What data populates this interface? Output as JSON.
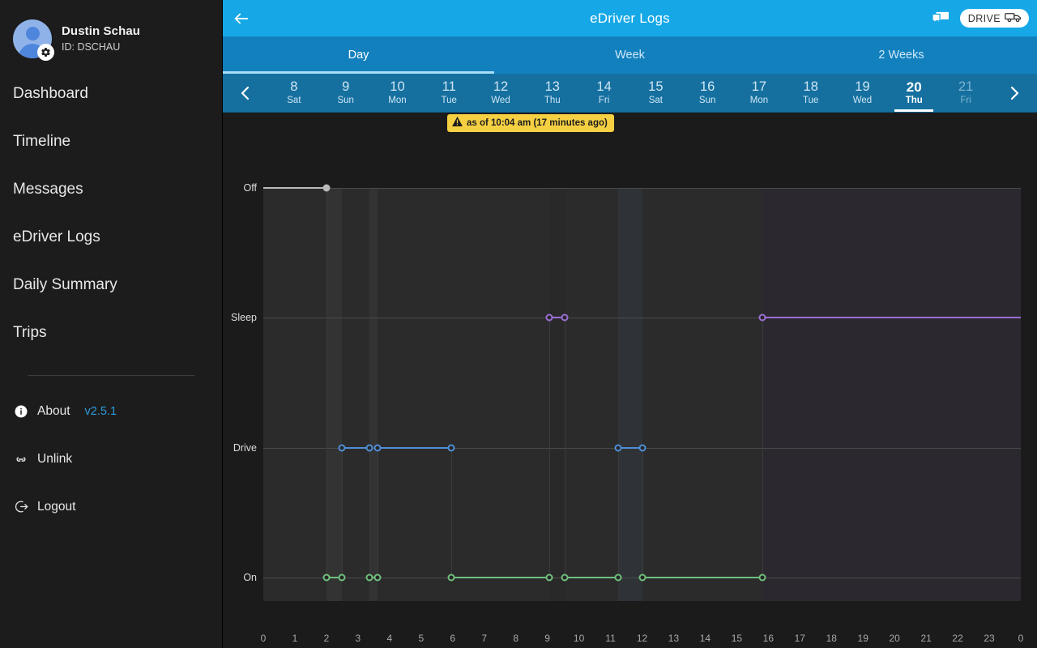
{
  "sidebar": {
    "profile": {
      "name": "Dustin Schau",
      "id": "ID: DSCHAU",
      "avatar_icon": "user-avatar-icon",
      "settings_icon": "gear-icon"
    },
    "nav_items": [
      {
        "label": "Dashboard",
        "name": "dashboard"
      },
      {
        "label": "Timeline",
        "name": "timeline"
      },
      {
        "label": "Messages",
        "name": "messages"
      },
      {
        "label": "eDriver Logs",
        "name": "edriver-logs"
      },
      {
        "label": "Daily Summary",
        "name": "daily-summary"
      },
      {
        "label": "Trips",
        "name": "trips"
      }
    ],
    "util_items": [
      {
        "label": "About",
        "icon": "info-icon",
        "name": "about"
      },
      {
        "label": "Unlink",
        "icon": "link-icon",
        "name": "unlink"
      },
      {
        "label": "Logout",
        "icon": "logout-icon",
        "name": "logout"
      }
    ],
    "version": "v2.5.1",
    "version_color": "#2e9bdc"
  },
  "header": {
    "title": "eDriver Logs",
    "back_icon": "back-arrow-icon",
    "messages_icon": "chat-bubble-icon",
    "status_pill": {
      "label": "DRIVE",
      "icon": "truck-icon"
    },
    "bg_color": "#16a8e6"
  },
  "range_tabs": [
    {
      "label": "Day",
      "active": true
    },
    {
      "label": "Week",
      "active": false
    },
    {
      "label": "2 Weeks",
      "active": false
    }
  ],
  "date_strip": {
    "prev_icon": "chevron-left-icon",
    "next_icon": "chevron-right-icon",
    "days": [
      {
        "num": "8",
        "name": "Sat",
        "selected": false,
        "future": false
      },
      {
        "num": "9",
        "name": "Sun",
        "selected": false,
        "future": false
      },
      {
        "num": "10",
        "name": "Mon",
        "selected": false,
        "future": false
      },
      {
        "num": "11",
        "name": "Tue",
        "selected": false,
        "future": false
      },
      {
        "num": "12",
        "name": "Wed",
        "selected": false,
        "future": false
      },
      {
        "num": "13",
        "name": "Thu",
        "selected": false,
        "future": false
      },
      {
        "num": "14",
        "name": "Fri",
        "selected": false,
        "future": false
      },
      {
        "num": "15",
        "name": "Sat",
        "selected": false,
        "future": false
      },
      {
        "num": "16",
        "name": "Sun",
        "selected": false,
        "future": false
      },
      {
        "num": "17",
        "name": "Mon",
        "selected": false,
        "future": false
      },
      {
        "num": "18",
        "name": "Tue",
        "selected": false,
        "future": false
      },
      {
        "num": "19",
        "name": "Wed",
        "selected": false,
        "future": false
      },
      {
        "num": "20",
        "name": "Thu",
        "selected": true,
        "future": false
      },
      {
        "num": "21",
        "name": "Fri",
        "selected": false,
        "future": true
      }
    ]
  },
  "as_of_badge": {
    "text": "as of 10:04 am (17 minutes ago)",
    "icon": "warning-triangle-icon",
    "bg_color": "#f6d043"
  },
  "chart_data": {
    "type": "line",
    "title": "eDriver Logs Duty Status",
    "xlabel": "",
    "ylabel": "",
    "grid": true,
    "legend": "none",
    "x": [
      0,
      1,
      2,
      3,
      4,
      5,
      6,
      7,
      8,
      9,
      10,
      11,
      12,
      13,
      14,
      15,
      16,
      17,
      18,
      19,
      20,
      21,
      22,
      23,
      24
    ],
    "xtick_labels": [
      "0",
      "1",
      "2",
      "3",
      "4",
      "5",
      "6",
      "7",
      "8",
      "9",
      "10",
      "11",
      "12",
      "13",
      "14",
      "15",
      "16",
      "17",
      "18",
      "19",
      "20",
      "21",
      "22",
      "23",
      "0"
    ],
    "xlim": [
      0,
      24
    ],
    "ytick_labels": [
      "Off",
      "Sleep",
      "Drive",
      "On"
    ],
    "ycategories": [
      "Off",
      "Sleep",
      "Drive",
      "On"
    ],
    "colors": {
      "off": "#b9b9b9",
      "sleep": "#9b6fd6",
      "drive": "#4f8fd6",
      "on": "#6fbf7d"
    },
    "series": [
      {
        "name": "Off",
        "color": "#b9b9b9",
        "status": "Off",
        "segments": [
          {
            "start_hour": 0.0,
            "end_hour": 2.0
          }
        ],
        "points": [
          {
            "hour": 2.0,
            "status": "Off"
          }
        ]
      },
      {
        "name": "Sleep",
        "color": "#9b6fd6",
        "status": "Sleep",
        "segments": [
          {
            "start_hour": 9.05,
            "end_hour": 9.55
          },
          {
            "start_hour": 15.8,
            "end_hour": 24.0
          }
        ],
        "points": [
          {
            "hour": 9.05
          },
          {
            "hour": 9.55
          },
          {
            "hour": 15.8
          }
        ]
      },
      {
        "name": "Drive",
        "color": "#4f8fd6",
        "status": "Drive",
        "segments": [
          {
            "start_hour": 2.5,
            "end_hour": 3.35
          },
          {
            "start_hour": 3.63,
            "end_hour": 5.95
          },
          {
            "start_hour": 11.25,
            "end_hour": 12.0
          }
        ],
        "points": [
          {
            "hour": 2.5
          },
          {
            "hour": 3.35
          },
          {
            "hour": 3.63
          },
          {
            "hour": 5.95
          },
          {
            "hour": 11.25
          },
          {
            "hour": 12.0
          }
        ]
      },
      {
        "name": "On",
        "color": "#6fbf7d",
        "status": "On",
        "segments": [
          {
            "start_hour": 2.0,
            "end_hour": 2.5
          },
          {
            "start_hour": 3.35,
            "end_hour": 3.63
          },
          {
            "start_hour": 5.95,
            "end_hour": 9.05
          },
          {
            "start_hour": 9.55,
            "end_hour": 11.25
          },
          {
            "start_hour": 12.0,
            "end_hour": 15.8
          }
        ],
        "points": [
          {
            "hour": 2.0
          },
          {
            "hour": 2.5
          },
          {
            "hour": 3.35
          },
          {
            "hour": 3.63
          },
          {
            "hour": 5.95
          },
          {
            "hour": 9.05
          },
          {
            "hour": 9.55
          },
          {
            "hour": 11.25
          },
          {
            "hour": 12.0
          },
          {
            "hour": 15.8
          }
        ]
      }
    ]
  }
}
